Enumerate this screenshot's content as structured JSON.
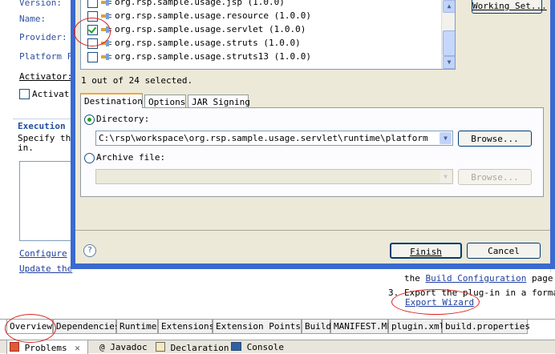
{
  "background_editor": {
    "labels": {
      "version": "Version:",
      "name": "Name:",
      "provider": "Provider:",
      "platform_filter": "Platform Fi",
      "activator": "Activator:",
      "activate_checkbox": "Activat"
    },
    "execution_section": {
      "title": "Execution",
      "desc_line1": "Specify the",
      "desc_line2": "in."
    },
    "configure_link": "Configure",
    "update_link": "Update the",
    "right_text": {
      "line1_prefix": "the",
      "line1_link": "Build Configuration",
      "line1_suffix": "page",
      "line2_num": "3.",
      "line2_text": "Export the plug-in in a format s",
      "line3_link": "Export Wizard"
    }
  },
  "dialog": {
    "plugin_list": [
      {
        "label": "org.rsp.sample.usage.jsp (1.0.0)",
        "checked": false
      },
      {
        "label": "org.rsp.sample.usage.resource (1.0.0)",
        "checked": false
      },
      {
        "label": "org.rsp.sample.usage.servlet (1.0.0)",
        "checked": true
      },
      {
        "label": "org.rsp.sample.usage.struts (1.0.0)",
        "checked": false
      },
      {
        "label": "org.rsp.sample.usage.struts13 (1.0.0)",
        "checked": false
      }
    ],
    "working_set_button": "Working Set...",
    "selection_status": "1 out of 24 selected.",
    "tabs": [
      {
        "label": "Destination",
        "active": true
      },
      {
        "label": "Options",
        "active": false
      },
      {
        "label": "JAR Signing",
        "active": false
      }
    ],
    "directory_radio": "Directory:",
    "directory_value": "C:\\rsp\\workspace\\org.rsp.sample.usage.servlet\\runtime\\platform",
    "browse_label": "Browse...",
    "archive_radio": "Archive file:",
    "archive_value": "",
    "browse2_label": "Browse...",
    "help_icon_glyph": "?",
    "finish_button": "Finish",
    "cancel_button": "Cancel"
  },
  "editor_tabs": [
    {
      "label": "Overview",
      "active": true
    },
    {
      "label": "Dependencies",
      "active": false
    },
    {
      "label": "Runtime",
      "active": false
    },
    {
      "label": "Extensions",
      "active": false
    },
    {
      "label": "Extension Points",
      "active": false
    },
    {
      "label": "Build",
      "active": false
    },
    {
      "label": "MANIFEST.MF",
      "active": false
    },
    {
      "label": "plugin.xml",
      "active": false
    },
    {
      "label": "build.properties",
      "active": false
    }
  ],
  "views": [
    {
      "label": "Problems",
      "icon": "problems-icon",
      "closable": true
    },
    {
      "label": "@ Javadoc",
      "icon": "javadoc-icon",
      "closable": false
    },
    {
      "label": "Declaration",
      "icon": "declaration-icon",
      "closable": false
    },
    {
      "label": "Console",
      "icon": "console-icon",
      "closable": false
    }
  ],
  "colors": {
    "dialog_frame": "#3a6ad0",
    "dialog_face": "#ece9d8",
    "annotation_red": "#e02020",
    "link_blue": "#2040a0"
  }
}
